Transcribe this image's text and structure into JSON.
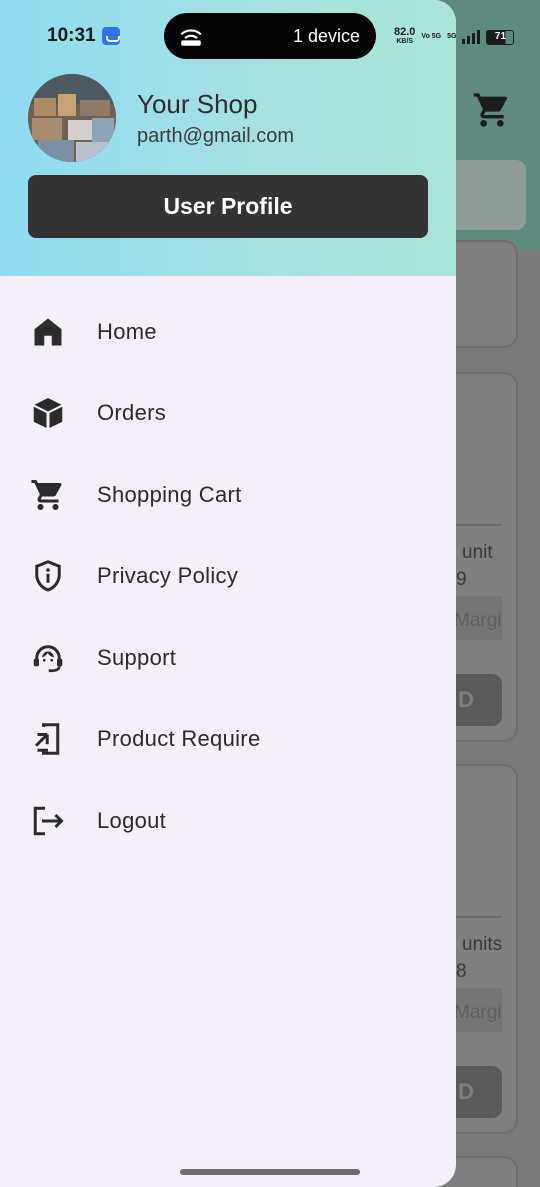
{
  "status_bar": {
    "time": "10:31",
    "pill_text": "1 device",
    "net_speed": "82.0",
    "net_unit": "KB/S",
    "volte": "Vo 5G",
    "network": "5G",
    "battery": "71"
  },
  "drawer": {
    "shop_name": "Your Shop",
    "email": "parth@gmail.com",
    "profile_button": "User Profile",
    "menu": [
      {
        "label": "Home",
        "icon": "home-icon"
      },
      {
        "label": "Orders",
        "icon": "box-icon"
      },
      {
        "label": "Shopping Cart",
        "icon": "cart-icon"
      },
      {
        "label": "Privacy Policy",
        "icon": "shield-info-icon"
      },
      {
        "label": "Support",
        "icon": "support-agent-icon"
      },
      {
        "label": "Product Require",
        "icon": "phone-forward-icon"
      },
      {
        "label": "Logout",
        "icon": "logout-icon"
      }
    ]
  },
  "background": {
    "card1": {
      "unit_text": "unit",
      "price_frag": "9",
      "margin_frag": "Margi",
      "button_frag": "D"
    },
    "card2": {
      "unit_text": "units",
      "price_frag": "8",
      "margin_frag": "Margi",
      "button_frag": "D"
    }
  }
}
